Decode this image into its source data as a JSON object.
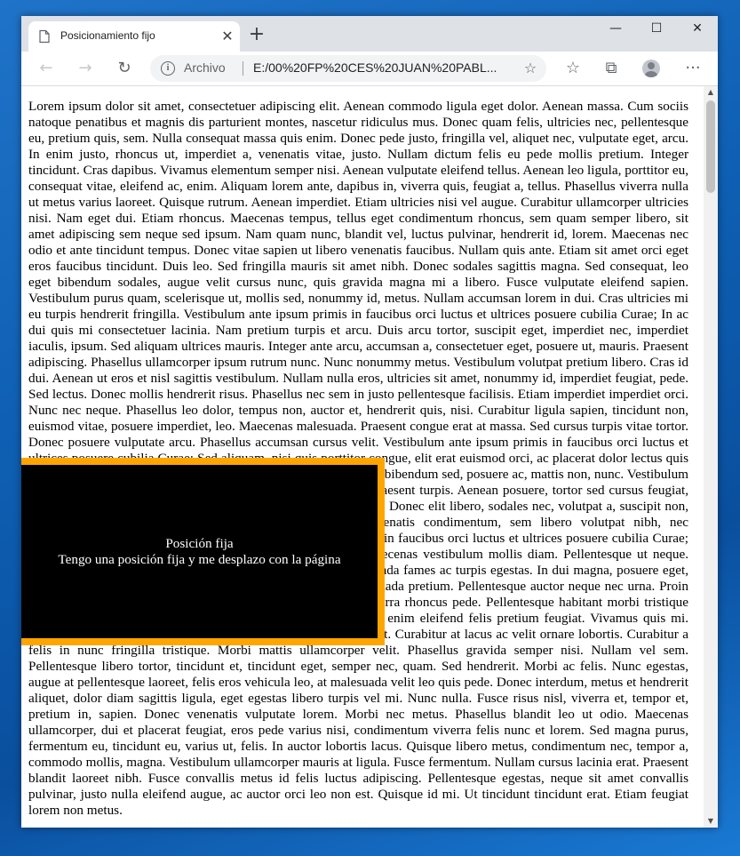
{
  "window": {
    "controls": {
      "minimize": "—",
      "maximize": "☐",
      "close": "✕"
    }
  },
  "tab": {
    "title": "Posicionamiento fijo",
    "close": "✕",
    "new_tab": "+"
  },
  "toolbar": {
    "back": "←",
    "forward": "→",
    "reload": "↻",
    "scheme": "Archivo",
    "url": "E:/00%20FP%20CES%20JUAN%20PABL...",
    "favorite": "☆",
    "favorites": "☆",
    "collections": "⧉",
    "menu": "···"
  },
  "page": {
    "body_text": "Lorem ipsum dolor sit amet, consectetuer adipiscing elit. Aenean commodo ligula eget dolor. Aenean massa. Cum sociis natoque penatibus et magnis dis parturient montes, nascetur ridiculus mus. Donec quam felis, ultricies nec, pellentesque eu, pretium quis, sem. Nulla consequat massa quis enim. Donec pede justo, fringilla vel, aliquet nec, vulputate eget, arcu. In enim justo, rhoncus ut, imperdiet a, venenatis vitae, justo. Nullam dictum felis eu pede mollis pretium. Integer tincidunt. Cras dapibus. Vivamus elementum semper nisi. Aenean vulputate eleifend tellus. Aenean leo ligula, porttitor eu, consequat vitae, eleifend ac, enim. Aliquam lorem ante, dapibus in, viverra quis, feugiat a, tellus. Phasellus viverra nulla ut metus varius laoreet. Quisque rutrum. Aenean imperdiet. Etiam ultricies nisi vel augue. Curabitur ullamcorper ultricies nisi. Nam eget dui. Etiam rhoncus. Maecenas tempus, tellus eget condimentum rhoncus, sem quam semper libero, sit amet adipiscing sem neque sed ipsum. Nam quam nunc, blandit vel, luctus pulvinar, hendrerit id, lorem. Maecenas nec odio et ante tincidunt tempus. Donec vitae sapien ut libero venenatis faucibus. Nullam quis ante. Etiam sit amet orci eget eros faucibus tincidunt. Duis leo. Sed fringilla mauris sit amet nibh. Donec sodales sagittis magna. Sed consequat, leo eget bibendum sodales, augue velit cursus nunc, quis gravida magna mi a libero. Fusce vulputate eleifend sapien. Vestibulum purus quam, scelerisque ut, mollis sed, nonummy id, metus. Nullam accumsan lorem in dui. Cras ultricies mi eu turpis hendrerit fringilla. Vestibulum ante ipsum primis in faucibus orci luctus et ultrices posuere cubilia Curae; In ac dui quis mi consectetuer lacinia. Nam pretium turpis et arcu. Duis arcu tortor, suscipit eget, imperdiet nec, imperdiet iaculis, ipsum. Sed aliquam ultrices mauris. Integer ante arcu, accumsan a, consectetuer eget, posuere ut, mauris. Praesent adipiscing. Phasellus ullamcorper ipsum rutrum nunc. Nunc nonummy metus. Vestibulum volutpat pretium libero. Cras id dui. Aenean ut eros et nisl sagittis vestibulum. Nullam nulla eros, ultricies sit amet, nonummy id, imperdiet feugiat, pede. Sed lectus. Donec mollis hendrerit risus. Phasellus nec sem in justo pellentesque facilisis. Etiam imperdiet imperdiet orci. Nunc nec neque. Phasellus leo dolor, tempus non, auctor et, hendrerit quis, nisi. Curabitur ligula sapien, tincidunt non, euismod vitae, posuere imperdiet, leo. Maecenas malesuada. Praesent congue erat at massa. Sed cursus turpis vitae tortor. Donec posuere vulputate arcu. Phasellus accumsan cursus velit. Vestibulum ante ipsum primis in faucibus orci luctus et ultrices posuere cubilia Curae; Sed aliquam, nisi quis porttitor congue, elit erat euismod orci, ac placerat dolor lectus quis orci. Phasellus consectetuer vestibulum elit. Aenean tellus metus, bibendum sed, posuere ac, mattis non, nunc. Vestibulum fringilla pede sit amet augue. In turpis. Pellentesque posuere. Praesent turpis. Aenean posuere, tortor sed cursus feugiat, nunc augue blandit nunc, eu sollicitudin urna dolor sagittis lacus. Donec elit libero, sodales nec, volutpat a, suscipit non, turpis. Nullam sagittis. Suspendisse pulvinar, augue ac venenatis condimentum, sem libero volutpat nibh, nec pellentesque velit pede quis nunc. Vestibulum ante ipsum primis in faucibus orci luctus et ultrices posuere cubilia Curae; Fusce id purus. Ut varius tincidunt libero. Phasellus dolor. Maecenas vestibulum mollis diam. Pellentesque ut neque. Pellentesque habitant morbi tristique senectus et netus et malesuada fames ac turpis egestas. In dui magna, posuere eget, vestibulum et, tempor auctor, justo. In ac felis quis tortor malesuada pretium. Pellentesque auctor neque nec urna. Proin sapien ipsum, porta a, auctor quis, euismod ut, mi. Aenean viverra rhoncus pede. Pellentesque habitant morbi tristique senectus et netus et malesuada fames ac turpis egestas. Ut non enim eleifend felis pretium feugiat. Vivamus quis mi. Phasellus a est. Phasellus magna. In hac habitasse platea dictumst. Curabitur at lacus ac velit ornare lobortis. Curabitur a felis in nunc fringilla tristique. Morbi mattis ullamcorper velit. Phasellus gravida semper nisi. Nullam vel sem. Pellentesque libero tortor, tincidunt et, tincidunt eget, semper nec, quam. Sed hendrerit. Morbi ac felis. Nunc egestas, augue at pellentesque laoreet, felis eros vehicula leo, at malesuada velit leo quis pede. Donec interdum, metus et hendrerit aliquet, dolor diam sagittis ligula, eget egestas libero turpis vel mi. Nunc nulla. Fusce risus nisl, viverra et, tempor et, pretium in, sapien. Donec venenatis vulputate lorem. Morbi nec metus. Phasellus blandit leo ut odio. Maecenas ullamcorper, dui et placerat feugiat, eros pede varius nisi, condimentum viverra felis nunc et lorem. Sed magna purus, fermentum eu, tincidunt eu, varius ut, felis. In auctor lobortis lacus. Quisque libero metus, condimentum nec, tempor a, commodo mollis, magna. Vestibulum ullamcorper mauris at ligula. Fusce fermentum. Nullam cursus lacinia erat. Praesent blandit laoreet nibh. Fusce convallis metus id felis luctus adipiscing. Pellentesque egestas, neque sit amet convallis pulvinar, justo nulla eleifend augue, ac auctor orci leo non est. Quisque id mi. Ut tincidunt tincidunt erat. Etiam feugiat lorem non metus.",
    "fixed_box": {
      "title": "Posición fija",
      "text": "Tengo una posición fija y me desplazo con la página",
      "border_color": "#ffa500",
      "background": "#000000"
    }
  },
  "scrollbar": {
    "up": "▲",
    "down": "▼"
  }
}
